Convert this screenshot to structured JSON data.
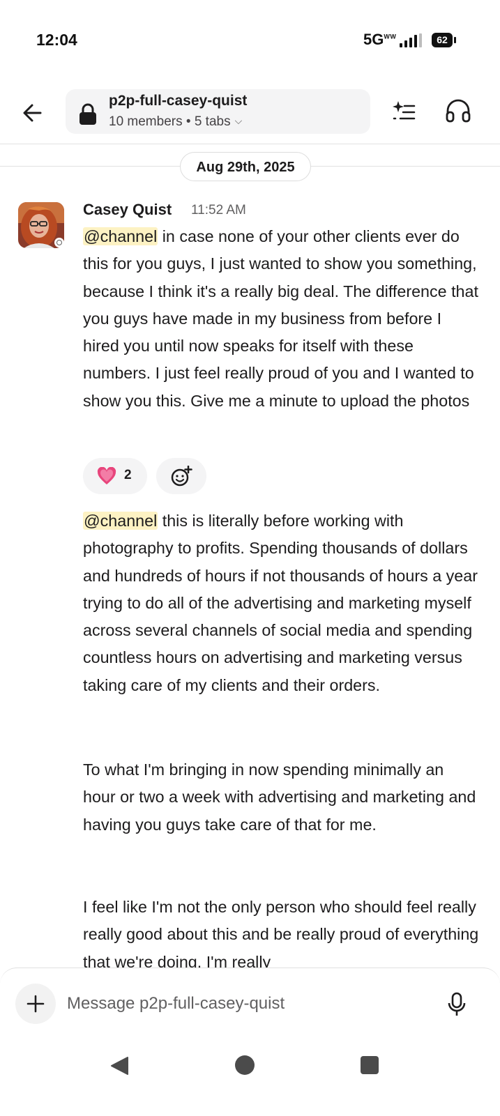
{
  "status_bar": {
    "time": "12:04",
    "network": "5G",
    "network_sub": "W W",
    "battery": "62"
  },
  "header": {
    "channel_name": "p2p-full-casey-quist",
    "members": "10 members",
    "separator": " • ",
    "tabs": "5 tabs",
    "icons": [
      "back-arrow-icon",
      "lock-icon",
      "chevron-down-icon",
      "ai-sparkle-list-icon",
      "headphones-icon"
    ]
  },
  "date_divider": "Aug 29th, 2025",
  "message": {
    "author": "Casey Quist",
    "time": "11:52 AM",
    "mention": "@channel",
    "first_text": " in case none of your other clients ever do this for you guys, I just wanted to show you something, because I think it's a really big deal. The difference that you guys have made in my business from before I hired you until now speaks for itself with these numbers. I just feel really proud of you and I wanted to show you this. Give me a minute to upload the photos",
    "reaction": {
      "emoji": "heart-sparkle-icon",
      "count": "2"
    },
    "second_text": " this is literally before working with photography to profits. Spending thousands of dollars and hundreds of hours if not thousands of hours a year trying to do all of the advertising and marketing myself across several channels of social media and spending countless hours on advertising and marketing versus taking care of my clients and their orders.",
    "third_text": "To what I'm bringing in now spending minimally an hour or two a week with advertising and marketing and having you guys take care of that for me.",
    "fourth_text": "I feel like I'm not the only person who should feel really really good about this and be really proud of everything that we're doing. I'm really"
  },
  "composer": {
    "placeholder": "Message p2p-full-casey-quist"
  },
  "colors": {
    "mention_bg": "#fdf2c3",
    "reaction_bg": "#f4f4f5",
    "heart": "#e8457c"
  }
}
